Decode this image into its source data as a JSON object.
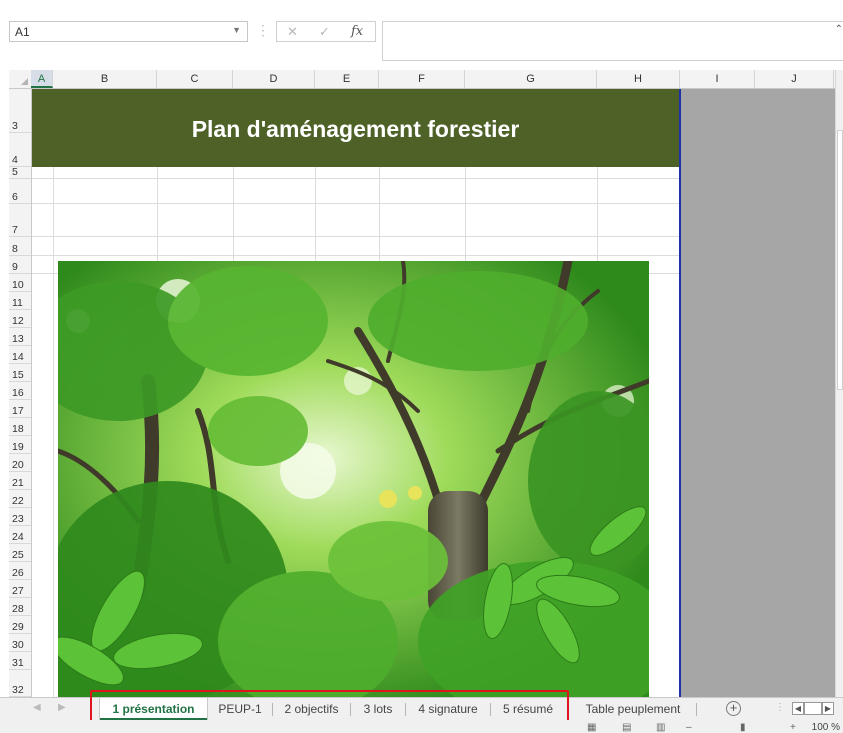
{
  "formula_bar": {
    "name_box": "A1",
    "cancel_symbol": "✕",
    "enter_symbol": "✓",
    "fx_symbol": "fx",
    "formula_value": ""
  },
  "columns": [
    "A",
    "B",
    "C",
    "D",
    "E",
    "F",
    "G",
    "H",
    "I",
    "J"
  ],
  "rows": [
    "3",
    "4",
    "5",
    "6",
    "7",
    "8",
    "9",
    "10",
    "11",
    "12",
    "13",
    "14",
    "15",
    "16",
    "17",
    "18",
    "19",
    "20",
    "21",
    "22",
    "23",
    "24",
    "25",
    "26",
    "27",
    "28",
    "29",
    "30",
    "31",
    "32"
  ],
  "sheet": {
    "title": "Plan d'aménagement forestier",
    "title_band_color": "#4e6228",
    "image_description_icon": "forest-canopy-photo"
  },
  "tabs": [
    {
      "label": "1 présentation",
      "active": true
    },
    {
      "label": "PEUP-1"
    },
    {
      "label": "2 objectifs"
    },
    {
      "label": "3 lots"
    },
    {
      "label": "4 signature"
    },
    {
      "label": "5 résumé"
    },
    {
      "label": "Table peuplement"
    }
  ],
  "status": {
    "zoom": "100 %"
  },
  "colors": {
    "accent": "#217346",
    "highlight_box": "#e0141e",
    "page_break_line": "#1f31a6"
  }
}
